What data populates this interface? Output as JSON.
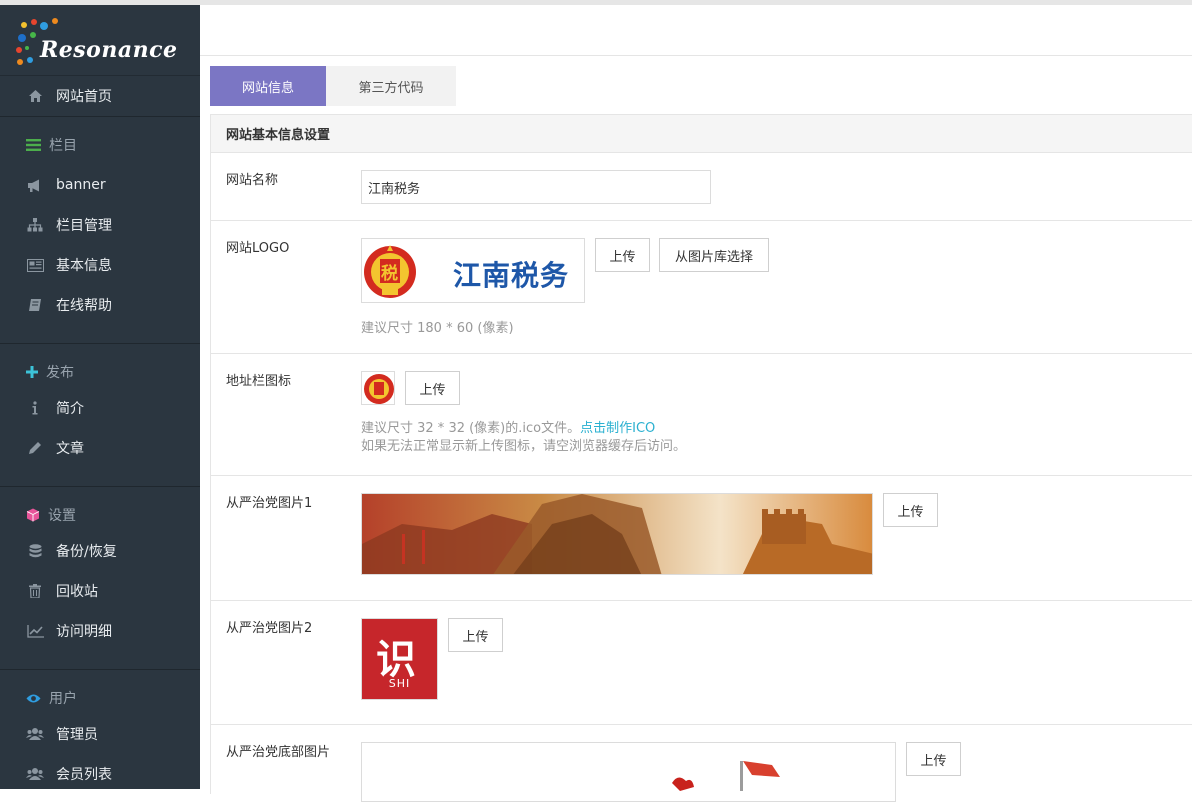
{
  "app": {
    "brand": "Resonance"
  },
  "sidebar": {
    "home": "网站首页",
    "section_lanmu": "栏目",
    "banner": "banner",
    "lanmu_manage": "栏目管理",
    "basic_info": "基本信息",
    "help": "在线帮助",
    "section_publish": "发布",
    "intro": "简介",
    "article": "文章",
    "section_settings": "设置",
    "backup": "备份/恢复",
    "recycle": "回收站",
    "visits": "访问明细",
    "section_users": "用户",
    "admins": "管理员",
    "members": "会员列表"
  },
  "tabs": {
    "site_info": "网站信息",
    "third_party": "第三方代码"
  },
  "panel": {
    "title": "网站基本信息设置"
  },
  "form": {
    "site_name_label": "网站名称",
    "site_name_value": "江南税务",
    "logo_label": "网站LOGO",
    "logo_text": "江南税务",
    "logo_glyph": "税",
    "upload": "上传",
    "choose_from_library": "从图片库选择",
    "logo_hint": "建议尺寸 180 * 60 (像素)",
    "favicon_label": "地址栏图标",
    "favicon_hint_prefix": "建议尺寸 32 * 32 (像素)的.ico文件。",
    "favicon_hint_link": "点击制作ICO",
    "favicon_hint_2": "如果无法正常显示新上传图标，请空浏览器缓存后访问。",
    "image1_label": "从严治党图片1",
    "image2_label": "从严治党图片2",
    "image2_glyph": "识",
    "image2_caption": "SHI",
    "bottom_image_label": "从严治党底部图片"
  },
  "colors": {
    "sidebar_bg": "#2b3640",
    "accent_tab": "#7b76c4",
    "link": "#2ab0d0",
    "section_green": "#4cae4c",
    "section_cyan": "#3cc3d8",
    "section_pink": "#e8559a",
    "section_blue": "#2f9de0"
  }
}
